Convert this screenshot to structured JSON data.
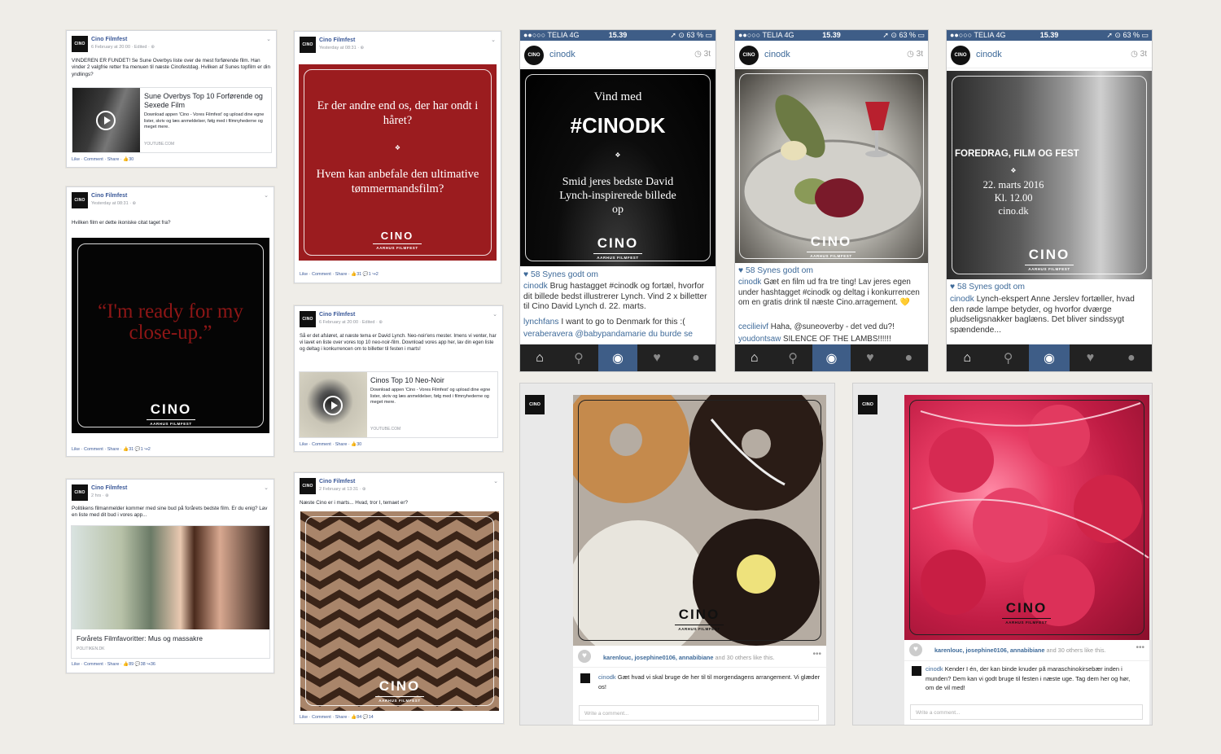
{
  "brand": {
    "logo_text": "CINO",
    "logo_sub": "AARHUS FILMFEST",
    "page_name": "Cino Filmfest"
  },
  "fb_posts": [
    {
      "meta": "6 February at 20:00 · Edited · ⊛",
      "text": "VINDEREN ER FUNDET! Se Sune Overbys liste over de mest forførende film. Han vinder 2 valgfrie retter fra menuen til næste Cinofestdag. Hvilken af Sunes topfilm er din yndlings?",
      "link_title": "Sune Overbys Top 10 Forførende og Sexede Film",
      "link_desc": "Download appen 'Cino - Vores Filmfest' og upload dine egne lister, skriv og læs anmeldelser, følg med i filmnyhederne og meget mere.",
      "link_src": "YOUTUBE.COM",
      "footer": "Like · Comment · Share · 👍30"
    },
    {
      "meta": "Yesterday at 08:31 · ⊛",
      "line1": "Er der andre end os, der har ondt i håret?",
      "line2": "Hvem kan anbefale den ultimative tømmermandsfilm?",
      "footer": "Like · Comment · Share · 👍31 💬1 ↪2"
    },
    {
      "meta": "Yesterday at 08:31 · ⊛",
      "text": "Hvilken film er dette ikoniske citat taget fra?",
      "quote": "“I'm ready for my close-up.”",
      "footer": "Like · Comment · Share · 👍31 💬1 ↪2"
    },
    {
      "meta": "6 February at 20:00 · Edited · ⊛",
      "text": "Så er det afsløret, at næste tema er David Lynch. Neo-noir'ens mester. Imens vi venter, har vi lavet en liste over vores top 10 neo-noir-film. Download vores app her, lav din egen liste og deltag i konkurrencen om to billetter til festen i marts!",
      "link_title": "Cinos Top 10 Neo-Noir",
      "link_desc": "Download appen 'Cino - Vores Filmfest' og upload dine egne lister, skriv og læs anmeldelser, følg med i filmnyhederne og meget mere.",
      "link_src": "YOUTUBE.COM",
      "footer": "Like · Comment · Share · 👍30"
    },
    {
      "meta": "2 hrs · ⊛",
      "text": "Politikens filmanmelder kommer med sine bud på forårets bedste film. Er du enig? Lav en liste med dit bud i vores app...",
      "link_title": "Forårets Filmfavoritter: Mus og massakre",
      "link_src": "POLITIKEN.DK",
      "footer": "Like · Comment · Share · 👍89 💬38 ↪36"
    },
    {
      "meta": "2 February at 13:31 · ⊛",
      "text": "Næste Cino er i marts... Hvad, tror I, temaet er?",
      "footer": "Like · Comment · Share · 👍84 💬14"
    }
  ],
  "ig_phones": [
    {
      "carrier": "●●○○○ TELIA  4G",
      "clock": "15.39",
      "battery": "➚ ⊙ 63 % ▭",
      "user": "cinodk",
      "time": "◷ 3t",
      "poster_l1": "Vind med",
      "poster_l2": "#CINODK",
      "poster_l3": "Smid jeres bedste David Lynch-inspirerede billede op",
      "likes": "♥ 58 Synes godt om",
      "caption_user": "cinodk",
      "caption": "Brug hastagget #cinodk og fortæl, hvorfor dit billede bedst illustrerer Lynch. Vind 2 x billetter til Cino David Lynch d. 22. marts.",
      "c1_user": "lynchfans",
      "c1": "I want to go to Denmark for this :(",
      "c2_user": "veraberavera",
      "c2": "@babypandamarie du burde se"
    },
    {
      "carrier": "●●○○○ TELIA  4G",
      "clock": "15.39",
      "battery": "➚ ⊙ 63 % ▭",
      "user": "cinodk",
      "time": "◷ 3t",
      "likes": "♥ 58 Synes godt om",
      "caption_user": "cinodk",
      "caption": "Gæt en film ud fra tre ting! Lav jeres egen under hashtagget #cinodk og deltag i konkurrencen om en gratis drink til næste Cino.arragement. 💛",
      "c1_user": "cecilieivf",
      "c1": "Haha, @suneoverby - det ved du?!",
      "c2_user": "youdontsaw",
      "c2": "SILENCE OF THE LAMBS!!!!!!"
    },
    {
      "carrier": "●●○○○ TELIA  4G",
      "clock": "15.39",
      "battery": "➚ ⊙ 63 % ▭",
      "user": "cinodk",
      "time": "◷ 3t",
      "poster_l1": "FOREDRAG, FILM OG FEST",
      "poster_l2": "22. marts 2016",
      "poster_l3": "Kl. 12.00",
      "poster_l4": "cino.dk",
      "likes": "♥ 58 Synes godt om",
      "caption_user": "cinodk",
      "caption": "Lynch-ekspert Anne Jerslev fortæller, hvad den røde  lampe betyder, og hvorfor dværge pludseligsnakker baglæns. Det bliver sindssygt spændende..."
    }
  ],
  "ig_web": [
    {
      "likes_users": "karenlouc, josephine0106, annabibiane",
      "likes_rest": " and 30 others like this.",
      "comment_user": "cinodk",
      "comment": "Gæt hvad vi skal bruge de her til til morgendagens arrangement. Vi glæder os!",
      "input": "Write a comment..."
    },
    {
      "likes_users": "karenlouc, josephine0106, annabibiane",
      "likes_rest": " and 30 others like this.",
      "comment_user": "cinodk",
      "comment": "Kender I én, der kan binde knuder på maraschinokirsebær inden i munden? Dem kan vi godt bruge til festen i næste uge. Tag dem her og hør, om de vil med!",
      "input": "Write a comment..."
    }
  ],
  "colors": {
    "fb_blue": "#3b5998",
    "ig_blue": "#3e5d87",
    "poster_red": "#9b1c1f",
    "quote_red": "#8e1616"
  }
}
